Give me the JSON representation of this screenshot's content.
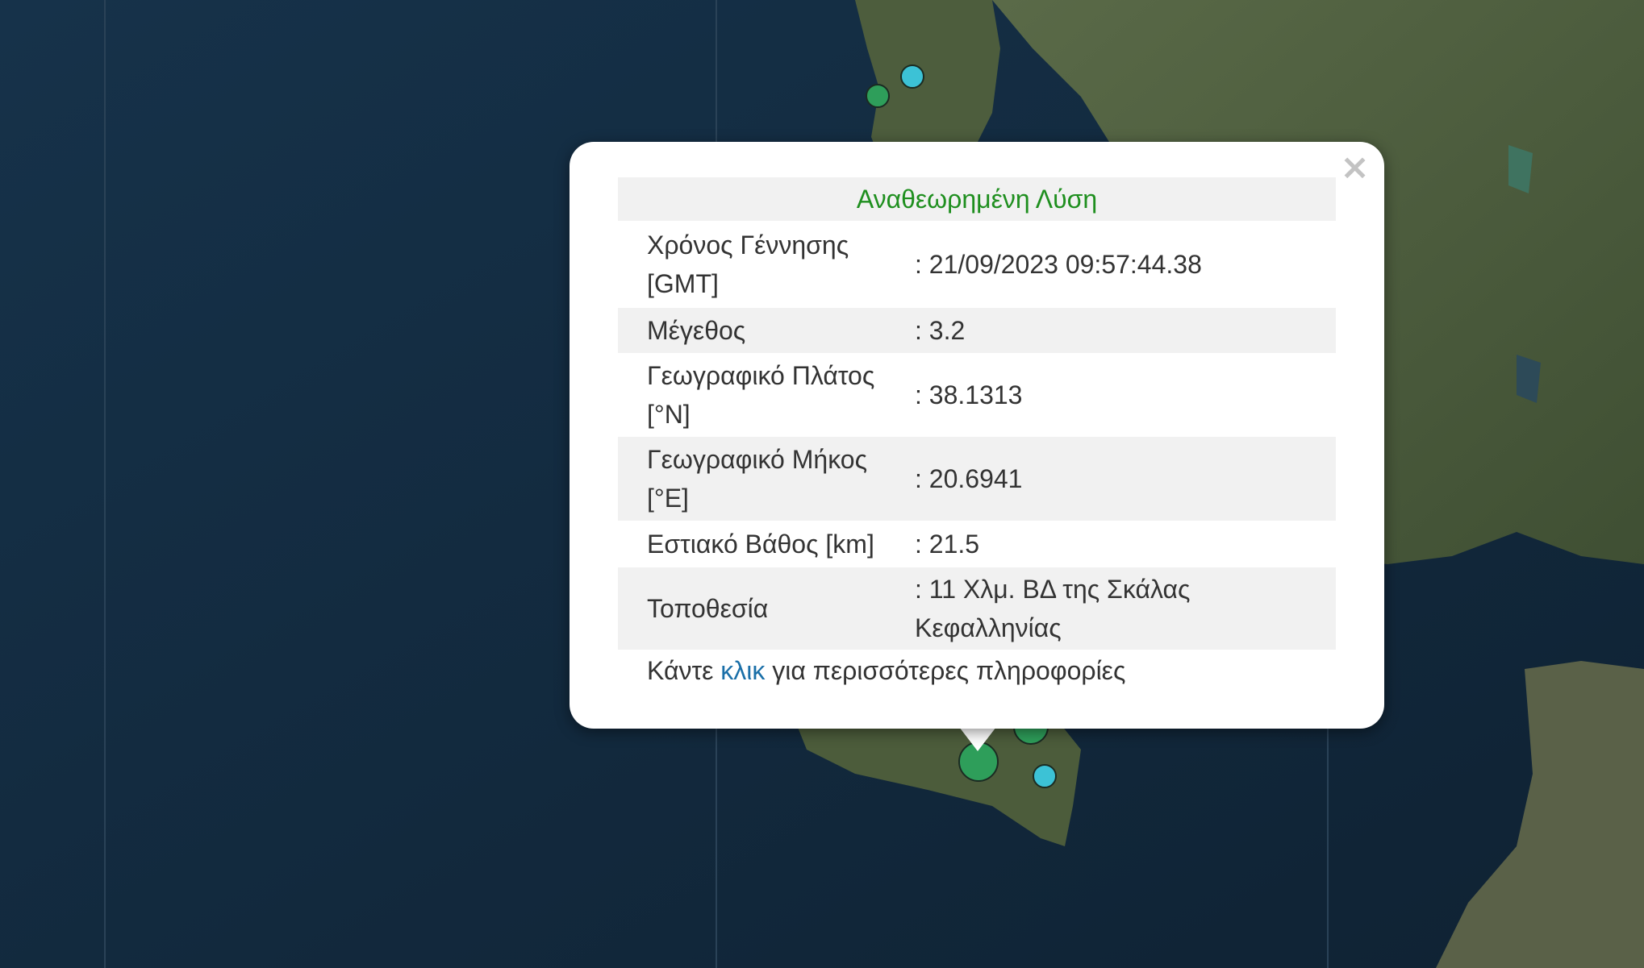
{
  "map": {
    "base_layer": "satellite imagery",
    "markers": [
      {
        "color": "green",
        "icon": "earthquake-marker"
      },
      {
        "color": "cyan",
        "icon": "earthquake-marker"
      }
    ]
  },
  "popup": {
    "close_label": "×",
    "title": "Αναθεωρημένη Λύση",
    "rows": [
      {
        "label": "Χρόνος Γέννησης [GMT]",
        "value": ": 21/09/2023 09:57:44.38"
      },
      {
        "label": "Μέγεθος",
        "value": ": 3.2"
      },
      {
        "label": "Γεωγραφικό Πλάτος [°N]",
        "value": ": 38.1313"
      },
      {
        "label": "Γεωγραφικό Μήκος [°E]",
        "value": ": 20.6941"
      },
      {
        "label": "Εστιακό Βάθος [km]",
        "value": ": 21.5"
      },
      {
        "label": "Τοποθεσία",
        "value": ": 11 Χλμ. ΒΔ της Σκάλας Κεφαλληνίας"
      }
    ],
    "footer": {
      "prefix": "Κάντε ",
      "link": "κλικ",
      "suffix": " για περισσότερες πληροφορίες"
    }
  },
  "colors": {
    "sea": "#13283a",
    "land": "#4a5b3c",
    "title_green": "#1f8f1f",
    "link_blue": "#1a6fa8",
    "marker_green": "#2e9e5a",
    "marker_cyan": "#3cc2d6"
  }
}
